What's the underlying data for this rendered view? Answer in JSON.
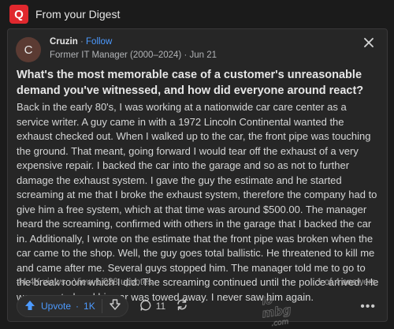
{
  "header": {
    "logo_letter": "Q",
    "title": "From your Digest"
  },
  "post": {
    "avatar_letter": "C",
    "author": "Cruzin",
    "separator": "·",
    "follow": "Follow",
    "credential": "Former IT Manager (2000–2024) · Jun 21",
    "question": "What's the most memorable case of a customer's unreasonable demand you've witnessed, and how did everyone around react?",
    "answer": "Back in the early 80's, I was working at a nationwide car care center as a service writer. A guy came in with a 1972 Lincoln Continental wanted the exhaust checked out. When I walked up to the car, the front pipe was touching the ground. That meant, going forward I would tear off the exhaust of a very expensive repair. I backed the car into the garage and so as not to further damage the exhaust system. I gave the guy the estimate and he started screaming at me that I broke the exhaust system, therefore the company had to give him a free system, which at that time was around $500.00. The manager heard the screaming, confirmed with others in the garage that I backed the car in. Additionally, I wrote on the estimate that the front pipe was broken when the car came to the shop. Well, the guy goes total ballistic. He threatened to kill me and came after me. Several guys stopped him. The manager told me to go to the break room which I did. The screaming continued until the police arrived. He was arrested and his car was towed away. I never saw him again.",
    "stats": "44.4K views · View 1,038 upvotes",
    "pager": "1 of 4 answers"
  },
  "actions": {
    "upvote_label": "Upvote",
    "upvote_sep": "·",
    "upvote_count": "1K",
    "comment_count": "11",
    "more": "•••"
  },
  "watermark": {
    "text": "lo mbg .com"
  },
  "colors": {
    "brand": "#e0282e",
    "accent": "#4c9aff",
    "background": "#1b1b1b",
    "card": "#262626"
  }
}
